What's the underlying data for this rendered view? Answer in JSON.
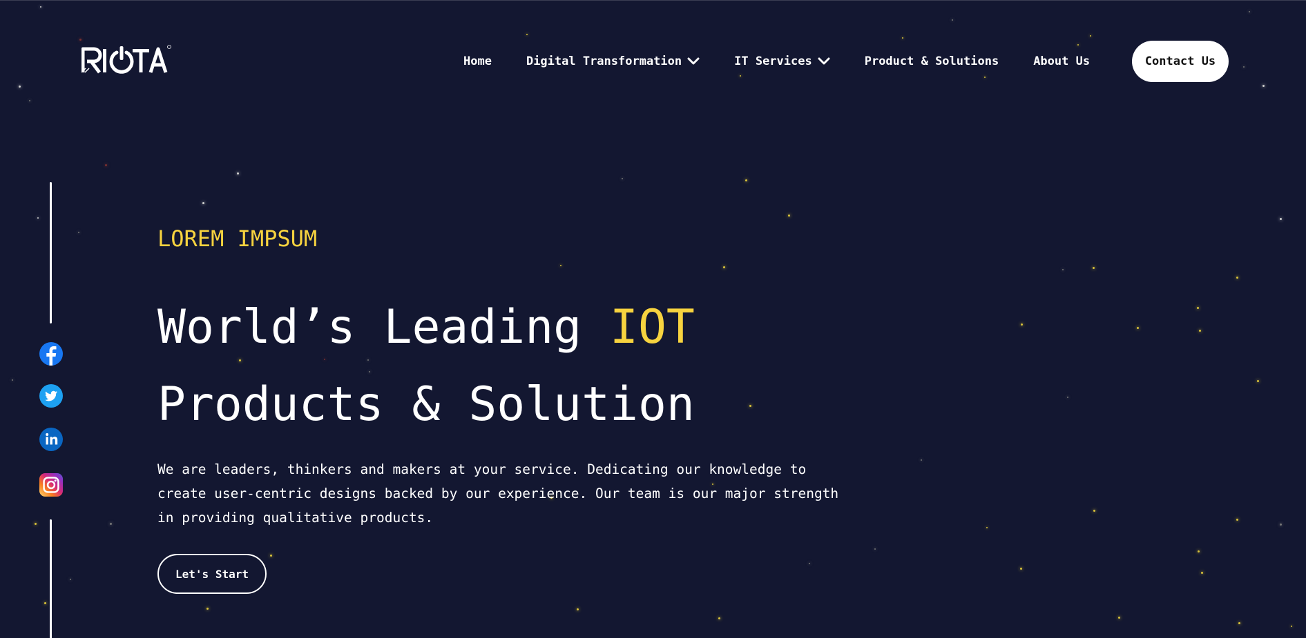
{
  "header": {
    "logo_text": "RIOTA",
    "nav": [
      {
        "label": "Home"
      },
      {
        "label": "Digital Transformation",
        "has_dropdown": true
      },
      {
        "label": "IT Services",
        "has_dropdown": true
      },
      {
        "label": "Product & Solutions"
      },
      {
        "label": "About Us"
      }
    ],
    "contact_label": "Contact Us"
  },
  "social": [
    {
      "name": "facebook-icon",
      "color": "#1877f2"
    },
    {
      "name": "twitter-icon",
      "color": "#1da1f2"
    },
    {
      "name": "linkedin-icon",
      "color": "#0a66c2"
    },
    {
      "name": "instagram-icon",
      "color": "#e1306c"
    }
  ],
  "hero": {
    "eyebrow": "LOREM IMPSUM",
    "headline_part1": "World’s Leading ",
    "headline_highlight": "IOT",
    "headline_line2": "Products & Solution",
    "description": "We are leaders, thinkers and makers at your service. Dedicating our knowledge to create user-centric designs backed by our experience. Our team is our major strength in providing qualitative products.",
    "cta_label": "Let's Start"
  },
  "colors": {
    "background": "#131731",
    "accent": "#f7d33f",
    "text": "#ffffff"
  }
}
